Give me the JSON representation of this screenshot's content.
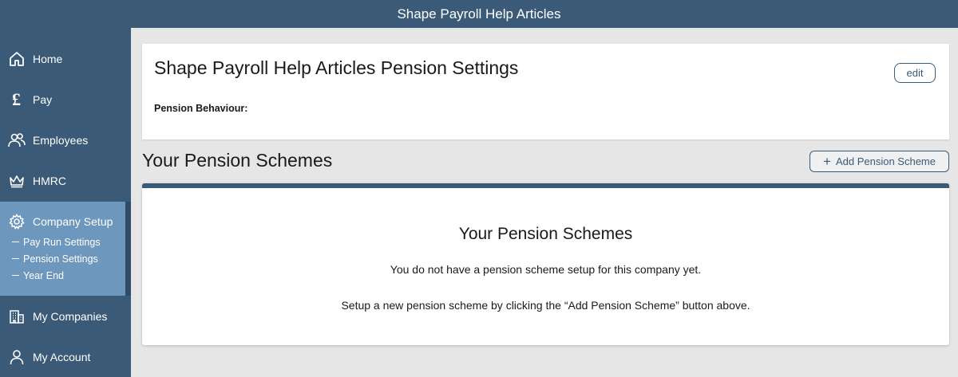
{
  "app": {
    "title": "Shape Payroll Help Articles"
  },
  "sidebar": {
    "items": [
      {
        "label": "Home",
        "icon": "home-icon"
      },
      {
        "label": "Pay",
        "icon": "pound-icon"
      },
      {
        "label": "Employees",
        "icon": "people-icon"
      },
      {
        "label": "HMRC",
        "icon": "crown-icon"
      },
      {
        "label": "Company Setup",
        "icon": "gear-icon",
        "active": true,
        "subitems": [
          {
            "label": "Pay Run Settings"
          },
          {
            "label": "Pension Settings"
          },
          {
            "label": "Year End"
          }
        ]
      },
      {
        "label": "My Companies",
        "icon": "building-icon"
      },
      {
        "label": "My Account",
        "icon": "person-icon"
      }
    ],
    "active_color": "#6d97bd",
    "bg_color": "#3a5a78"
  },
  "settings_card": {
    "title": "Shape Payroll Help Articles Pension Settings",
    "field_label": "Pension Behaviour:",
    "edit_label": "edit"
  },
  "schemes": {
    "section_title": "Your Pension Schemes",
    "add_button_label": "Add Pension Scheme",
    "empty_heading": "Your Pension Schemes",
    "empty_line1": "You do not have a pension scheme setup for this company yet.",
    "empty_line2": "Setup a new pension scheme by clicking the “Add Pension Scheme” button above."
  }
}
